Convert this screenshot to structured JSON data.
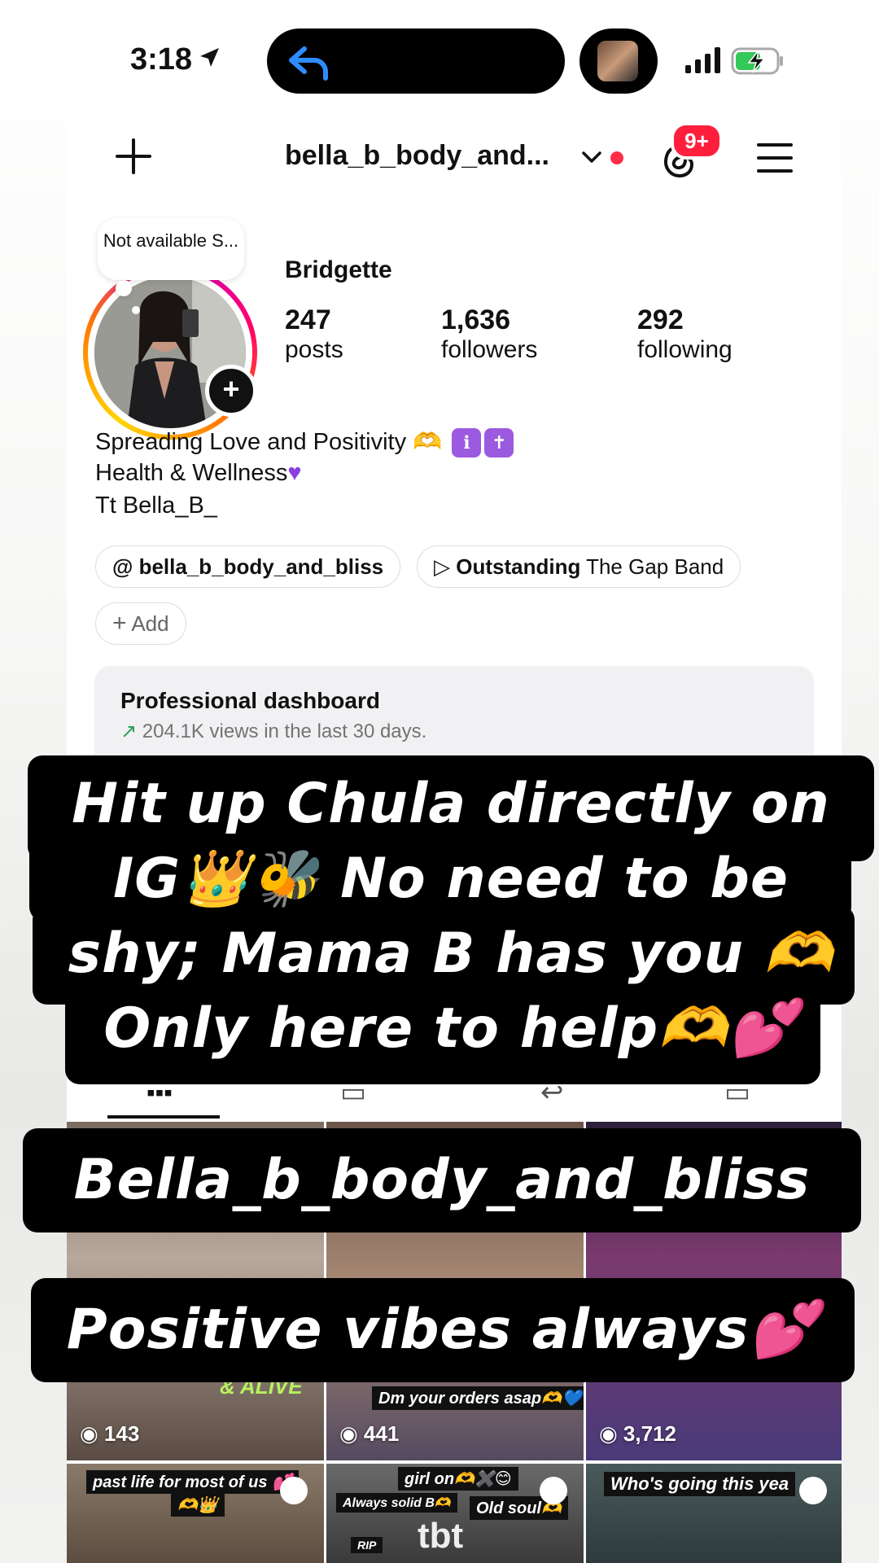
{
  "status_bar": {
    "time": "3:18"
  },
  "header": {
    "username": "bella_b_body_and...",
    "notification_badge": "9+"
  },
  "profile": {
    "note": "Not available S...",
    "display_name": "Bridgette",
    "stats": [
      {
        "value": "247",
        "label": "posts"
      },
      {
        "value": "1,636",
        "label": "followers"
      },
      {
        "value": "292",
        "label": "following"
      }
    ],
    "bio": [
      "Spreading Love and Positivity",
      "Health & Wellness",
      "Tt Bella_B_"
    ],
    "link_chip": "bella_b_body_and_bliss",
    "music_chip_bold": "Outstanding",
    "music_chip_rest": "The Gap Band",
    "add_label": "Add"
  },
  "dashboard": {
    "title": "Professional dashboard",
    "subtitle": "204.1K views in the last 30 days."
  },
  "overlay": {
    "lines": [
      "Hit up Chula directly on",
      "IG👑🐝  No need to be",
      "shy; Mama B has you 🫶",
      "Only here to help🫶💕"
    ],
    "handle": "Bella_b_body_and_bliss",
    "tagline": "Positive vibes always💕"
  },
  "grid": {
    "views": [
      "143",
      "441",
      "3,712"
    ],
    "captions": {
      "c1": "& ALIVE",
      "c2": "Dm your orders asap🫶💙",
      "c4": "past life for most of us 💕",
      "c4b": "🫶👑",
      "c5a": "girl on🫶✖️😊",
      "c5b": "Always solid B🫶",
      "c5c": "Old soul🫶",
      "c5d": "tbt",
      "c5e": "RIP",
      "c6": "Who's going this yea"
    }
  },
  "colors": {
    "accent_red": "#ff1f3d",
    "link_green": "#2b9d5a"
  }
}
